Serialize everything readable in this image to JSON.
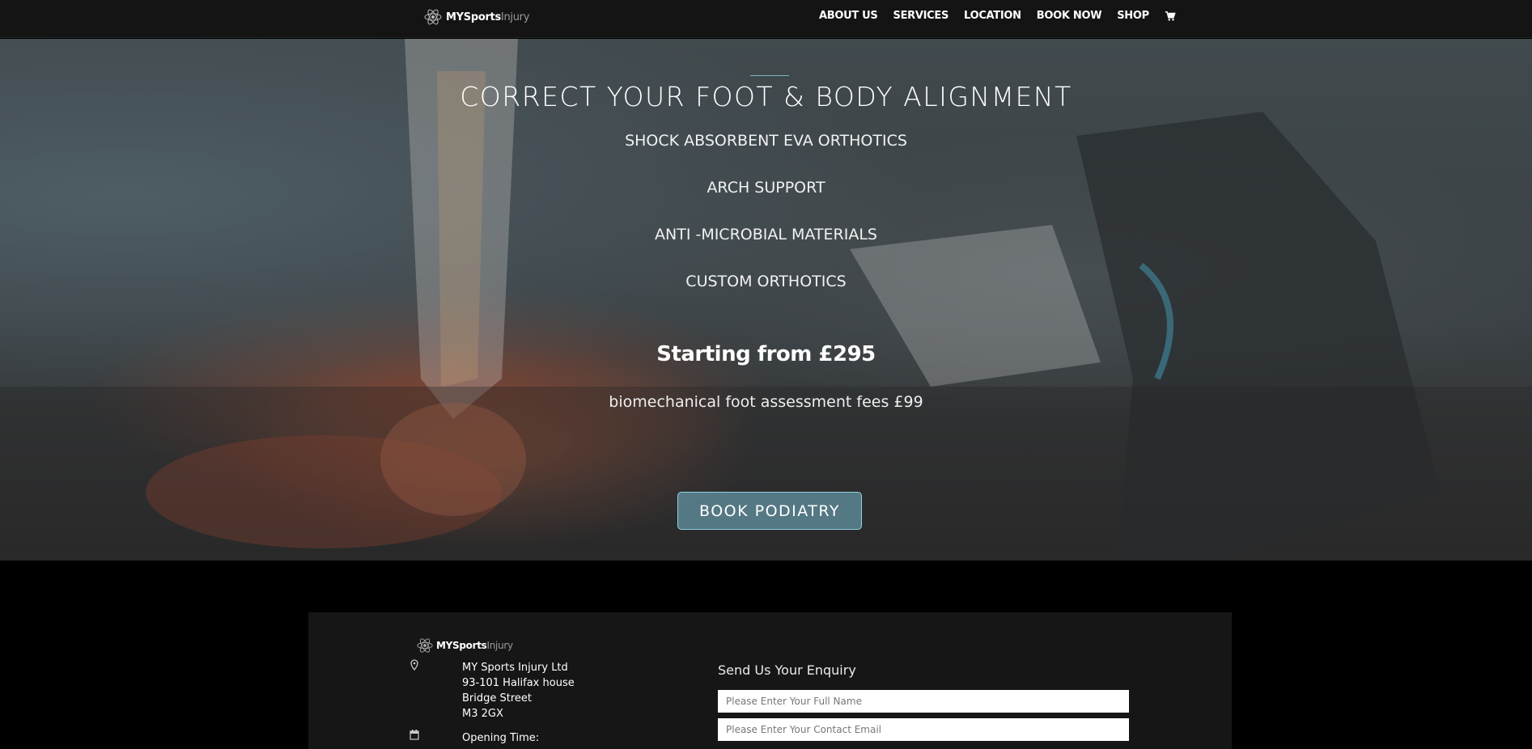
{
  "header": {
    "logo": {
      "bold": "MYSports",
      "light": "Injury"
    },
    "nav": [
      "ABOUT US",
      "SERVICES",
      "LOCATION",
      "BOOK NOW",
      "SHOP"
    ],
    "cart_icon": "cart-icon"
  },
  "hero": {
    "title": "CORRECT YOUR FOOT & BODY ALIGNMENT",
    "features": [
      "SHOCK ABSORBENT EVA ORTHOTICS",
      "ARCH SUPPORT",
      "ANTI -MICROBIAL MATERIALS",
      "CUSTOM ORTHOTICS"
    ],
    "price": "Starting from £295",
    "fees": "biomechanical foot assessment fees £99",
    "button": "BOOK PODIATRY",
    "accent": "#8fd2e3"
  },
  "footer": {
    "logo": {
      "bold": "MYSports",
      "light": "Injury"
    },
    "address": [
      "MY Sports Injury Ltd",
      "93-101 Halifax house",
      "Bridge Street",
      "M3 2GX"
    ],
    "opening_label": "Opening Time:",
    "enquiry": {
      "title": "Send Us Your Enquiry",
      "name_placeholder": "Please Enter Your Full Name",
      "email_placeholder": "Please Enter Your Contact Email"
    }
  }
}
